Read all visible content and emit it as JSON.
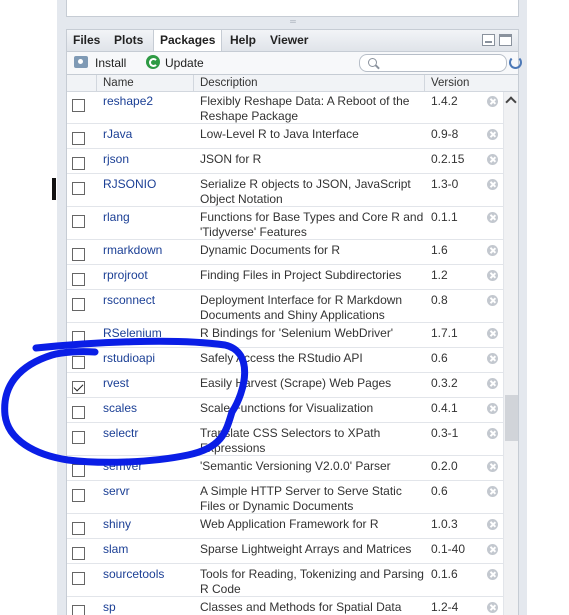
{
  "tabs": [
    {
      "label": "Files",
      "active": false
    },
    {
      "label": "Plots",
      "active": false
    },
    {
      "label": "Packages",
      "active": true
    },
    {
      "label": "Help",
      "active": false
    },
    {
      "label": "Viewer",
      "active": false
    }
  ],
  "toolbar": {
    "install_label": "Install",
    "update_label": "Update",
    "search_placeholder": ""
  },
  "table": {
    "headers": [
      "Name",
      "Description",
      "Version"
    ],
    "rows": [
      {
        "name": "reshape2",
        "description": "Flexibly Reshape Data: A Reboot of the Reshape Package",
        "version": "1.4.2",
        "checked": false
      },
      {
        "name": "rJava",
        "description": "Low-Level R to Java Interface",
        "version": "0.9-8",
        "checked": false
      },
      {
        "name": "rjson",
        "description": "JSON for R",
        "version": "0.2.15",
        "checked": false
      },
      {
        "name": "RJSONIO",
        "description": "Serialize R objects to JSON, JavaScript Object Notation",
        "version": "1.3-0",
        "checked": false
      },
      {
        "name": "rlang",
        "description": "Functions for Base Types and Core R and 'Tidyverse' Features",
        "version": "0.1.1",
        "checked": false
      },
      {
        "name": "rmarkdown",
        "description": "Dynamic Documents for R",
        "version": "1.6",
        "checked": false
      },
      {
        "name": "rprojroot",
        "description": "Finding Files in Project Subdirectories",
        "version": "1.2",
        "checked": false
      },
      {
        "name": "rsconnect",
        "description": "Deployment Interface for R Markdown Documents and Shiny Applications",
        "version": "0.8",
        "checked": false
      },
      {
        "name": "RSelenium",
        "description": "R Bindings for 'Selenium WebDriver'",
        "version": "1.7.1",
        "checked": false
      },
      {
        "name": "rstudioapi",
        "description": "Safely Access the RStudio API",
        "version": "0.6",
        "checked": false
      },
      {
        "name": "rvest",
        "description": "Easily Harvest (Scrape) Web Pages",
        "version": "0.3.2",
        "checked": true
      },
      {
        "name": "scales",
        "description": "Scale Functions for Visualization",
        "version": "0.4.1",
        "checked": false
      },
      {
        "name": "selectr",
        "description": "Translate CSS Selectors to XPath Expressions",
        "version": "0.3-1",
        "checked": false
      },
      {
        "name": "semver",
        "description": "'Semantic Versioning V2.0.0' Parser",
        "version": "0.2.0",
        "checked": false
      },
      {
        "name": "servr",
        "description": "A Simple HTTP Server to Serve Static Files or Dynamic Documents",
        "version": "0.6",
        "checked": false
      },
      {
        "name": "shiny",
        "description": "Web Application Framework for R",
        "version": "1.0.3",
        "checked": false
      },
      {
        "name": "slam",
        "description": "Sparse Lightweight Arrays and Matrices",
        "version": "0.1-40",
        "checked": false
      },
      {
        "name": "sourcetools",
        "description": "Tools for Reading, Tokenizing and Parsing R Code",
        "version": "0.1.6",
        "checked": false
      },
      {
        "name": "sp",
        "description": "Classes and Methods for Spatial Data",
        "version": "1.2-4",
        "checked": false
      }
    ]
  },
  "colors": {
    "link": "#1b3f95",
    "annotation": "#0a1ee6",
    "update_icon": "#2e9a44"
  }
}
